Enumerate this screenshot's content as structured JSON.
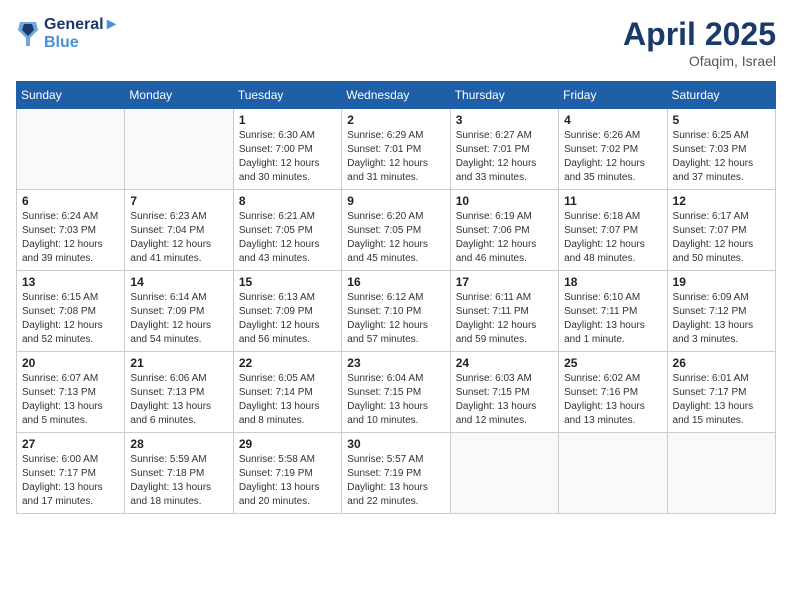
{
  "header": {
    "logo_line1": "General",
    "logo_line2": "Blue",
    "month_year": "April 2025",
    "location": "Ofaqim, Israel"
  },
  "weekdays": [
    "Sunday",
    "Monday",
    "Tuesday",
    "Wednesday",
    "Thursday",
    "Friday",
    "Saturday"
  ],
  "weeks": [
    [
      {
        "day": "",
        "info": ""
      },
      {
        "day": "",
        "info": ""
      },
      {
        "day": "1",
        "info": "Sunrise: 6:30 AM\nSunset: 7:00 PM\nDaylight: 12 hours\nand 30 minutes."
      },
      {
        "day": "2",
        "info": "Sunrise: 6:29 AM\nSunset: 7:01 PM\nDaylight: 12 hours\nand 31 minutes."
      },
      {
        "day": "3",
        "info": "Sunrise: 6:27 AM\nSunset: 7:01 PM\nDaylight: 12 hours\nand 33 minutes."
      },
      {
        "day": "4",
        "info": "Sunrise: 6:26 AM\nSunset: 7:02 PM\nDaylight: 12 hours\nand 35 minutes."
      },
      {
        "day": "5",
        "info": "Sunrise: 6:25 AM\nSunset: 7:03 PM\nDaylight: 12 hours\nand 37 minutes."
      }
    ],
    [
      {
        "day": "6",
        "info": "Sunrise: 6:24 AM\nSunset: 7:03 PM\nDaylight: 12 hours\nand 39 minutes."
      },
      {
        "day": "7",
        "info": "Sunrise: 6:23 AM\nSunset: 7:04 PM\nDaylight: 12 hours\nand 41 minutes."
      },
      {
        "day": "8",
        "info": "Sunrise: 6:21 AM\nSunset: 7:05 PM\nDaylight: 12 hours\nand 43 minutes."
      },
      {
        "day": "9",
        "info": "Sunrise: 6:20 AM\nSunset: 7:05 PM\nDaylight: 12 hours\nand 45 minutes."
      },
      {
        "day": "10",
        "info": "Sunrise: 6:19 AM\nSunset: 7:06 PM\nDaylight: 12 hours\nand 46 minutes."
      },
      {
        "day": "11",
        "info": "Sunrise: 6:18 AM\nSunset: 7:07 PM\nDaylight: 12 hours\nand 48 minutes."
      },
      {
        "day": "12",
        "info": "Sunrise: 6:17 AM\nSunset: 7:07 PM\nDaylight: 12 hours\nand 50 minutes."
      }
    ],
    [
      {
        "day": "13",
        "info": "Sunrise: 6:15 AM\nSunset: 7:08 PM\nDaylight: 12 hours\nand 52 minutes."
      },
      {
        "day": "14",
        "info": "Sunrise: 6:14 AM\nSunset: 7:09 PM\nDaylight: 12 hours\nand 54 minutes."
      },
      {
        "day": "15",
        "info": "Sunrise: 6:13 AM\nSunset: 7:09 PM\nDaylight: 12 hours\nand 56 minutes."
      },
      {
        "day": "16",
        "info": "Sunrise: 6:12 AM\nSunset: 7:10 PM\nDaylight: 12 hours\nand 57 minutes."
      },
      {
        "day": "17",
        "info": "Sunrise: 6:11 AM\nSunset: 7:11 PM\nDaylight: 12 hours\nand 59 minutes."
      },
      {
        "day": "18",
        "info": "Sunrise: 6:10 AM\nSunset: 7:11 PM\nDaylight: 13 hours\nand 1 minute."
      },
      {
        "day": "19",
        "info": "Sunrise: 6:09 AM\nSunset: 7:12 PM\nDaylight: 13 hours\nand 3 minutes."
      }
    ],
    [
      {
        "day": "20",
        "info": "Sunrise: 6:07 AM\nSunset: 7:13 PM\nDaylight: 13 hours\nand 5 minutes."
      },
      {
        "day": "21",
        "info": "Sunrise: 6:06 AM\nSunset: 7:13 PM\nDaylight: 13 hours\nand 6 minutes."
      },
      {
        "day": "22",
        "info": "Sunrise: 6:05 AM\nSunset: 7:14 PM\nDaylight: 13 hours\nand 8 minutes."
      },
      {
        "day": "23",
        "info": "Sunrise: 6:04 AM\nSunset: 7:15 PM\nDaylight: 13 hours\nand 10 minutes."
      },
      {
        "day": "24",
        "info": "Sunrise: 6:03 AM\nSunset: 7:15 PM\nDaylight: 13 hours\nand 12 minutes."
      },
      {
        "day": "25",
        "info": "Sunrise: 6:02 AM\nSunset: 7:16 PM\nDaylight: 13 hours\nand 13 minutes."
      },
      {
        "day": "26",
        "info": "Sunrise: 6:01 AM\nSunset: 7:17 PM\nDaylight: 13 hours\nand 15 minutes."
      }
    ],
    [
      {
        "day": "27",
        "info": "Sunrise: 6:00 AM\nSunset: 7:17 PM\nDaylight: 13 hours\nand 17 minutes."
      },
      {
        "day": "28",
        "info": "Sunrise: 5:59 AM\nSunset: 7:18 PM\nDaylight: 13 hours\nand 18 minutes."
      },
      {
        "day": "29",
        "info": "Sunrise: 5:58 AM\nSunset: 7:19 PM\nDaylight: 13 hours\nand 20 minutes."
      },
      {
        "day": "30",
        "info": "Sunrise: 5:57 AM\nSunset: 7:19 PM\nDaylight: 13 hours\nand 22 minutes."
      },
      {
        "day": "",
        "info": ""
      },
      {
        "day": "",
        "info": ""
      },
      {
        "day": "",
        "info": ""
      }
    ]
  ]
}
